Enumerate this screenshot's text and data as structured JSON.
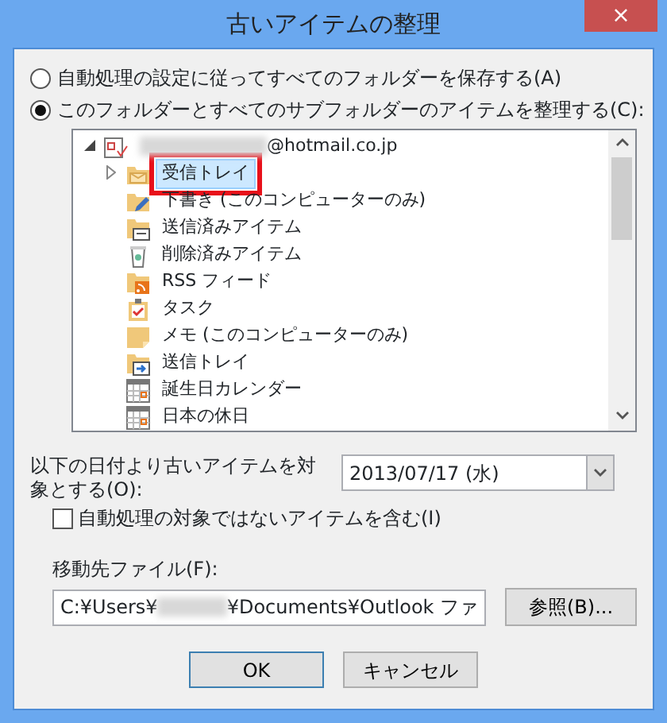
{
  "window": {
    "title": "古いアイテムの整理",
    "close": "×"
  },
  "options": [
    {
      "label": "自動処理の設定に従ってすべてのフォルダーを保存する(A)",
      "selected": false
    },
    {
      "label": "このフォルダーとすべてのサブフォルダーのアイテムを整理する(C):",
      "selected": true
    }
  ],
  "tree": {
    "items": [
      {
        "label": "@hotmail.co.jp",
        "kind": "account",
        "expanded": true,
        "selected": false,
        "children": [
          {
            "label": "受信トレイ",
            "kind": "inbox",
            "expanded": false,
            "selected": true
          },
          {
            "label": "下書き (このコンピューターのみ)",
            "kind": "drafts",
            "selected": false
          },
          {
            "label": "送信済みアイテム",
            "kind": "sent",
            "selected": false
          },
          {
            "label": "削除済みアイテム",
            "kind": "deleted",
            "selected": false
          },
          {
            "label": "RSS フィード",
            "kind": "rss",
            "selected": false
          },
          {
            "label": "タスク",
            "kind": "tasks",
            "selected": false
          },
          {
            "label": "メモ (このコンピューターのみ)",
            "kind": "notes",
            "selected": false
          },
          {
            "label": "送信トレイ",
            "kind": "outbox",
            "selected": false
          },
          {
            "label": "誕生日カレンダー",
            "kind": "calendar",
            "selected": false
          },
          {
            "label": "日本の休日",
            "kind": "calendar",
            "selected": false
          }
        ]
      }
    ]
  },
  "date": {
    "label": "以下の日付より古いアイテムを対象とする(O):",
    "value": "2013/07/17 (水)"
  },
  "include_checkbox": {
    "label": "自動処理の対象ではないアイテムを含む(I)",
    "checked": false
  },
  "move_to": {
    "label": "移動先ファイル(F):",
    "value_start": "C:¥Users¥",
    "value_end": "¥Documents¥Outlook ファ",
    "browse": "参照(B)..."
  },
  "buttons": [
    "OK",
    "キャンセル"
  ]
}
